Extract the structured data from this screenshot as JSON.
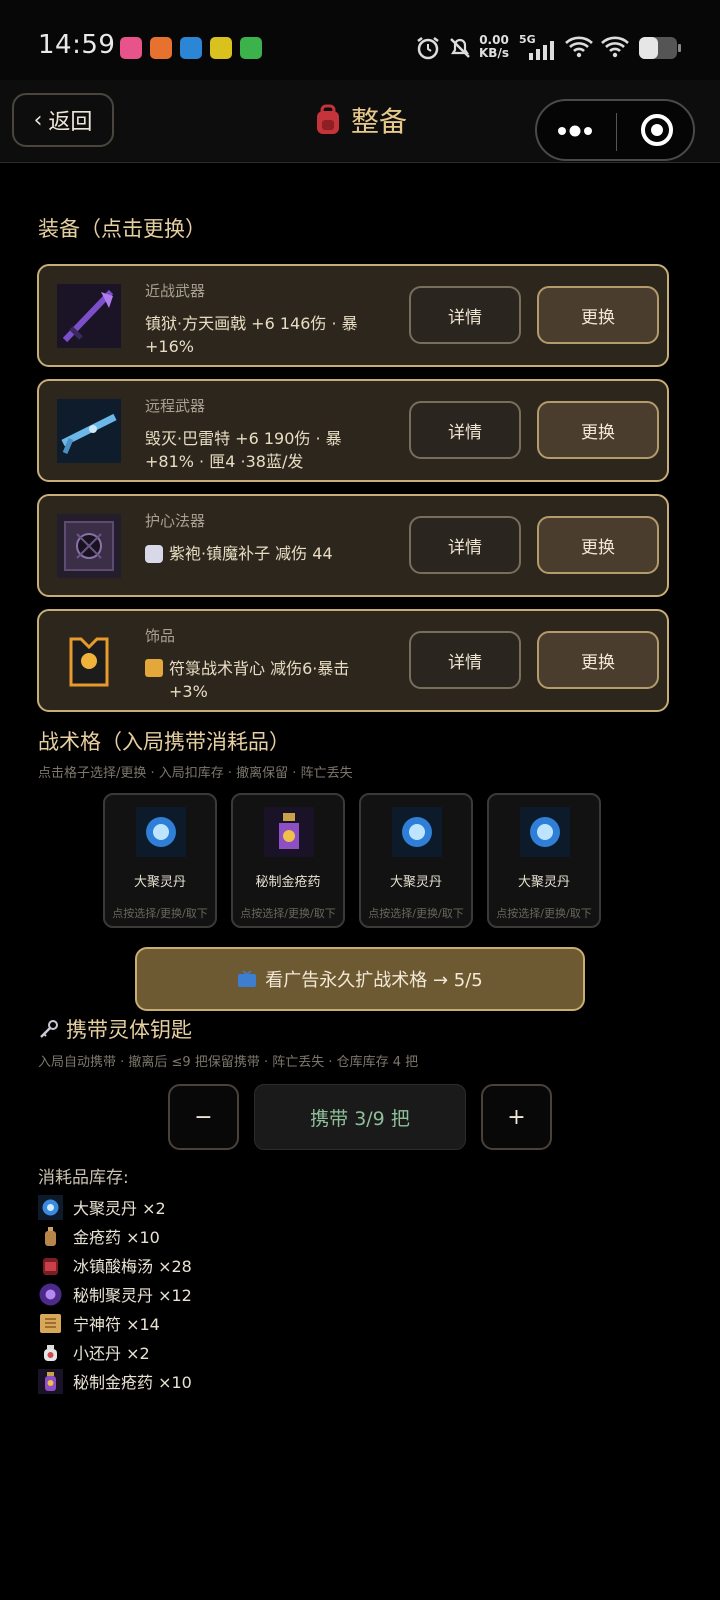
{
  "status_bar": {
    "time": "14:59",
    "net_speed_value": "0.00",
    "net_speed_unit": "KB/s",
    "signal": "5G"
  },
  "nav": {
    "back_label": "返回",
    "title": "整备"
  },
  "equipment": {
    "title": "装备（点击更换）",
    "items": [
      {
        "slot": "近战武器",
        "desc": "镇狱·方天画戟 +6  146伤 · 暴+16%",
        "detail": "详情",
        "swap": "更换",
        "icon": "purple-halberd-icon"
      },
      {
        "slot": "远程武器",
        "desc": "毁灭·巴雷特 +6  190伤 · 暴+81% · 匣4 ·38蓝/发",
        "detail": "详情",
        "swap": "更换",
        "icon": "blue-rifle-icon"
      },
      {
        "slot": "护心法器",
        "desc": "紫袍·镇魔补子  减伤 44",
        "detail": "详情",
        "swap": "更换",
        "icon": "dark-armor-patch-icon"
      },
      {
        "slot": "饰品",
        "desc": "符箓战术背心  减伤6·暴击+3%",
        "detail": "详情",
        "swap": "更换",
        "icon": "tactical-vest-icon"
      }
    ]
  },
  "tactical": {
    "title": "战术格（入局携带消耗品）",
    "hint": "点击格子选择/更换 · 入局扣库存 · 撤离保留 · 阵亡丢失",
    "slots": [
      {
        "name": "大聚灵丹",
        "tip": "点按选择/更换/取下"
      },
      {
        "name": "秘制金疮药",
        "tip": "点按选择/更换/取下"
      },
      {
        "name": "大聚灵丹",
        "tip": "点按选择/更换/取下"
      },
      {
        "name": "大聚灵丹",
        "tip": "点按选择/更换/取下"
      }
    ],
    "ad_button": "看广告永久扩战术格 → 5/5"
  },
  "keys": {
    "title": "携带灵体钥匙",
    "hint": "入局自动携带 · 撤离后 ≤9 把保留携带 · 阵亡丢失 · 仓库库存 4 把",
    "minus": "−",
    "plus": "+",
    "carry": "携带 3/9 把"
  },
  "inventory": {
    "title": "消耗品库存:",
    "items": [
      {
        "label": "大聚灵丹 ×2",
        "icon": "spirit-orb-icon"
      },
      {
        "label": "金疮药 ×10",
        "icon": "potion-bottle-icon"
      },
      {
        "label": "冰镇酸梅汤 ×28",
        "icon": "plum-drink-icon"
      },
      {
        "label": "秘制聚灵丹 ×12",
        "icon": "purple-orb-icon"
      },
      {
        "label": "宁神符 ×14",
        "icon": "talisman-icon"
      },
      {
        "label": "小还丹 ×2",
        "icon": "small-pill-icon"
      },
      {
        "label": "秘制金疮药 ×10",
        "icon": "secret-potion-icon"
      }
    ]
  },
  "colors": {
    "accent_gold": "#c7ad78",
    "title_gold": "#e6cfa0",
    "card_bg": "#2c261d",
    "carry_green": "#8fbf9a"
  }
}
